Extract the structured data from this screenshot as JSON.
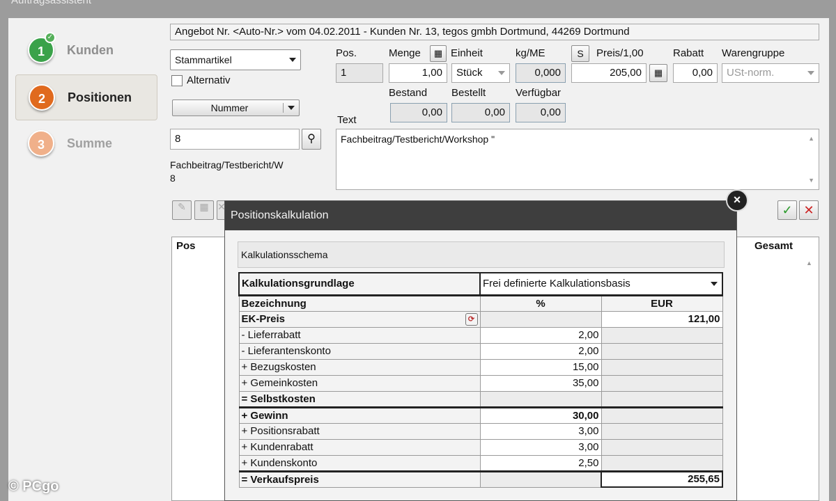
{
  "window_title": "Auftragsassistent",
  "steps": [
    {
      "number": "1",
      "label": "Kunden"
    },
    {
      "number": "2",
      "label": "Positionen"
    },
    {
      "number": "3",
      "label": "Summe"
    }
  ],
  "header_info": "Angebot Nr. <Auto-Nr.> vom 04.02.2011 - Kunden Nr. 13, tegos gmbh Dortmund, 44269 Dortmund",
  "article_type": "Stammartikel",
  "alternativ_label": "Alternativ",
  "nummer_button": "Nummer",
  "search_value": "8",
  "article_desc_line1": "Fachbeitrag/Testbericht/W",
  "article_desc_line2": "8",
  "fields": {
    "pos_label": "Pos.",
    "pos_value": "1",
    "menge_label": "Menge",
    "menge_value": "1,00",
    "einheit_label": "Einheit",
    "einheit_value": "Stück",
    "kgme_label": "kg/ME",
    "kgme_value": "0,000",
    "s_button": "S",
    "preis_label": "Preis/1,00",
    "preis_value": "205,00",
    "rabatt_label": "Rabatt",
    "rabatt_value": "0,00",
    "warengruppe_label": "Warengruppe",
    "warengruppe_value": "USt-norm.",
    "bestand_label": "Bestand",
    "bestand_value": "0,00",
    "bestellt_label": "Bestellt",
    "bestellt_value": "0,00",
    "verfuegbar_label": "Verfügbar",
    "verfuegbar_value": "0,00",
    "text_label": "Text",
    "text_value": "Fachbeitrag/Testbericht/Workshop \""
  },
  "grid": {
    "col_pos": "Pos",
    "col_gesamt": "Gesamt"
  },
  "dialog": {
    "title": "Positionskalkulation",
    "close": "×",
    "schema_label": "Kalkulationsschema",
    "grundlage_label": "Kalkulationsgrundlage",
    "grundlage_value": "Frei definierte Kalkulationsbasis",
    "headers": {
      "bezeichnung": "Bezeichnung",
      "percent": "%",
      "eur": "EUR"
    },
    "rows": [
      {
        "label": "EK-Preis",
        "pct": "",
        "eur": "121,00"
      },
      {
        "label": "- Lieferrabatt",
        "pct": "2,00",
        "eur": ""
      },
      {
        "label": "- Lieferantenskonto",
        "pct": "2,00",
        "eur": ""
      },
      {
        "label": "+ Bezugskosten",
        "pct": "15,00",
        "eur": ""
      },
      {
        "label": "+ Gemeinkosten",
        "pct": "35,00",
        "eur": ""
      },
      {
        "label": "= Selbstkosten",
        "pct": "",
        "eur": ""
      },
      {
        "label": "+ Gewinn",
        "pct": "30,00",
        "eur": ""
      },
      {
        "label": "+ Positionsrabatt",
        "pct": "3,00",
        "eur": ""
      },
      {
        "label": "+ Kundenrabatt",
        "pct": "3,00",
        "eur": ""
      },
      {
        "label": "+ Kundenskonto",
        "pct": "2,50",
        "eur": ""
      },
      {
        "label": "= Verkaufspreis",
        "pct": "",
        "eur": "255,65"
      }
    ]
  },
  "watermark": "© PCgo"
}
